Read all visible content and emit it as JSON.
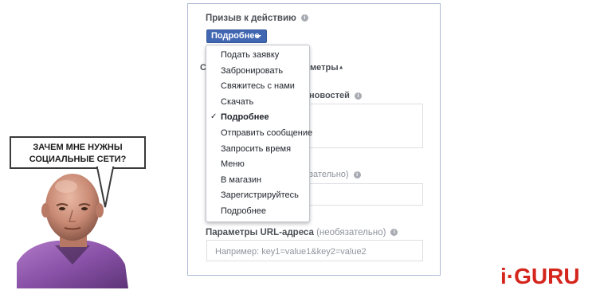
{
  "cta": {
    "label": "Призыв к действию",
    "button_label": "Подробнее"
  },
  "obscured": {
    "frag_c": "С",
    "frag_params": "метры",
    "frag_news": "новостей",
    "frag_optional": "зательно)"
  },
  "menu": {
    "items": [
      {
        "label": "Подать заявку",
        "selected": false
      },
      {
        "label": "Забронировать",
        "selected": false
      },
      {
        "label": "Свяжитесь с нами",
        "selected": false
      },
      {
        "label": "Скачать",
        "selected": false
      },
      {
        "label": "Подробнее",
        "selected": true
      },
      {
        "label": "Отправить сообщение",
        "selected": false
      },
      {
        "label": "Запросить время",
        "selected": false
      },
      {
        "label": "Меню",
        "selected": false
      },
      {
        "label": "В магазин",
        "selected": false
      },
      {
        "label": "Зарегистрируйтесь",
        "selected": false
      },
      {
        "label": "Подробнее",
        "selected": false
      }
    ],
    "check_glyph": "✓"
  },
  "url_params": {
    "label": "Параметры URL-адреса",
    "optional": "(необязательно)",
    "placeholder": "Например: key1=value1&key2=value2"
  },
  "meme": {
    "line1": "ЗАЧЕМ МНЕ НУЖНЫ",
    "line2": "СОЦИАЛЬНЫЕ СЕТИ?"
  },
  "logo": {
    "text": "i·GURU",
    "color": "#d4261d"
  },
  "colors": {
    "button": "#4267b2",
    "panel_border": "#aebbd6"
  }
}
